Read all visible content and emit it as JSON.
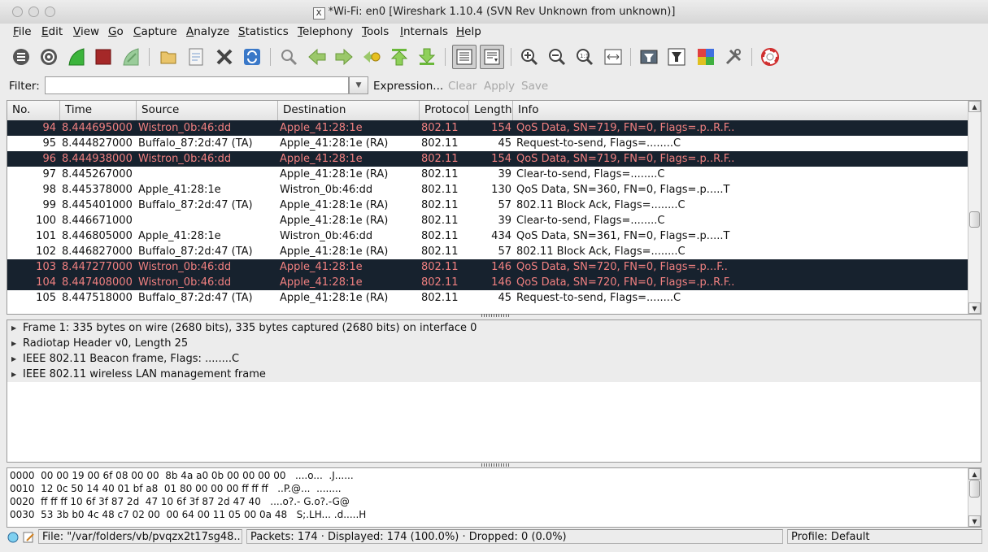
{
  "window": {
    "title": "*Wi-Fi: en0   [Wireshark 1.10.4  (SVN Rev Unknown from unknown)]",
    "x_logo": "X"
  },
  "menu": [
    "File",
    "Edit",
    "View",
    "Go",
    "Capture",
    "Analyze",
    "Statistics",
    "Telephony",
    "Tools",
    "Internals",
    "Help"
  ],
  "toolbar": {
    "buttons": [
      "interface-list",
      "capture-options",
      "start-capture",
      "stop-capture",
      "restart-capture",
      "open-file",
      "save-file",
      "close-file",
      "reload-file",
      "find-packet",
      "go-back",
      "go-forward",
      "go-to-packet",
      "go-first-packet",
      "go-last-packet",
      "colorize",
      "auto-scroll",
      "zoom-in",
      "zoom-out",
      "normal-size",
      "resize-columns",
      "capture-filters",
      "display-filters",
      "coloring-rules",
      "preferences",
      "help"
    ]
  },
  "filter": {
    "label": "Filter:",
    "value": "",
    "expression": "Expression...",
    "clear": "Clear",
    "apply": "Apply",
    "save": "Save"
  },
  "columns": [
    "No.",
    "Time",
    "Source",
    "Destination",
    "Protocol",
    "Length",
    "Info"
  ],
  "packets": [
    {
      "no": "94",
      "time": "8.444695000",
      "src": "Wistron_0b:46:dd",
      "dst": "Apple_41:28:1e",
      "proto": "802.11",
      "len": "154",
      "info": "QoS Data, SN=719, FN=0, Flags=.p..R.F..",
      "sel": true
    },
    {
      "no": "95",
      "time": "8.444827000",
      "src": "Buffalo_87:2d:47 (TA)",
      "dst": "Apple_41:28:1e (RA)",
      "proto": "802.11",
      "len": "45",
      "info": "Request-to-send, Flags=........C",
      "sel": false
    },
    {
      "no": "96",
      "time": "8.444938000",
      "src": "Wistron_0b:46:dd",
      "dst": "Apple_41:28:1e",
      "proto": "802.11",
      "len": "154",
      "info": "QoS Data, SN=719, FN=0, Flags=.p..R.F..",
      "sel": true
    },
    {
      "no": "97",
      "time": "8.445267000",
      "src": "",
      "dst": "Apple_41:28:1e (RA)",
      "proto": "802.11",
      "len": "39",
      "info": "Clear-to-send, Flags=........C",
      "sel": false
    },
    {
      "no": "98",
      "time": "8.445378000",
      "src": "Apple_41:28:1e",
      "dst": "Wistron_0b:46:dd",
      "proto": "802.11",
      "len": "130",
      "info": "QoS Data, SN=360, FN=0, Flags=.p.....T",
      "sel": false
    },
    {
      "no": "99",
      "time": "8.445401000",
      "src": "Buffalo_87:2d:47 (TA)",
      "dst": "Apple_41:28:1e (RA)",
      "proto": "802.11",
      "len": "57",
      "info": "802.11 Block Ack, Flags=........C",
      "sel": false
    },
    {
      "no": "100",
      "time": "8.446671000",
      "src": "",
      "dst": "Apple_41:28:1e (RA)",
      "proto": "802.11",
      "len": "39",
      "info": "Clear-to-send, Flags=........C",
      "sel": false
    },
    {
      "no": "101",
      "time": "8.446805000",
      "src": "Apple_41:28:1e",
      "dst": "Wistron_0b:46:dd",
      "proto": "802.11",
      "len": "434",
      "info": "QoS Data, SN=361, FN=0, Flags=.p.....T",
      "sel": false
    },
    {
      "no": "102",
      "time": "8.446827000",
      "src": "Buffalo_87:2d:47 (TA)",
      "dst": "Apple_41:28:1e (RA)",
      "proto": "802.11",
      "len": "57",
      "info": "802.11 Block Ack, Flags=........C",
      "sel": false
    },
    {
      "no": "103",
      "time": "8.447277000",
      "src": "Wistron_0b:46:dd",
      "dst": "Apple_41:28:1e",
      "proto": "802.11",
      "len": "146",
      "info": "QoS Data, SN=720, FN=0, Flags=.p...F..",
      "sel": true
    },
    {
      "no": "104",
      "time": "8.447408000",
      "src": "Wistron_0b:46:dd",
      "dst": "Apple_41:28:1e",
      "proto": "802.11",
      "len": "146",
      "info": "QoS Data, SN=720, FN=0, Flags=.p..R.F..",
      "sel": true
    },
    {
      "no": "105",
      "time": "8.447518000",
      "src": "Buffalo_87:2d:47 (TA)",
      "dst": "Apple_41:28:1e (RA)",
      "proto": "802.11",
      "len": "45",
      "info": "Request-to-send, Flags=........C",
      "sel": false
    }
  ],
  "details": [
    "Frame 1: 335 bytes on wire (2680 bits), 335 bytes captured (2680 bits) on interface 0",
    "Radiotap Header v0, Length 25",
    "IEEE 802.11 Beacon frame, Flags: ........C",
    "IEEE 802.11 wireless LAN management frame"
  ],
  "bytes": [
    "0000  00 00 19 00 6f 08 00 00  8b 4a a0 0b 00 00 00 00   ....o...  .J......",
    "0010  12 0c 50 14 40 01 bf a8  01 80 00 00 00 ff ff ff   ..P.@...  ........",
    "0020  ff ff ff 10 6f 3f 87 2d  47 10 6f 3f 87 2d 47 40   ....o?.- G.o?.-G@",
    "0030  53 3b b0 4c 48 c7 02 00  00 64 00 11 05 00 0a 48   S;.LH... .d.....H"
  ],
  "status": {
    "file": "File: \"/var/folders/vb/pvqzx2t17sg48...",
    "packets": "Packets: 174 · Displayed: 174 (100.0%)  · Dropped: 0 (0.0%)",
    "profile": "Profile: Default"
  },
  "colors": {
    "selected_bg": "#17222e",
    "selected_fg": "#f08080"
  }
}
